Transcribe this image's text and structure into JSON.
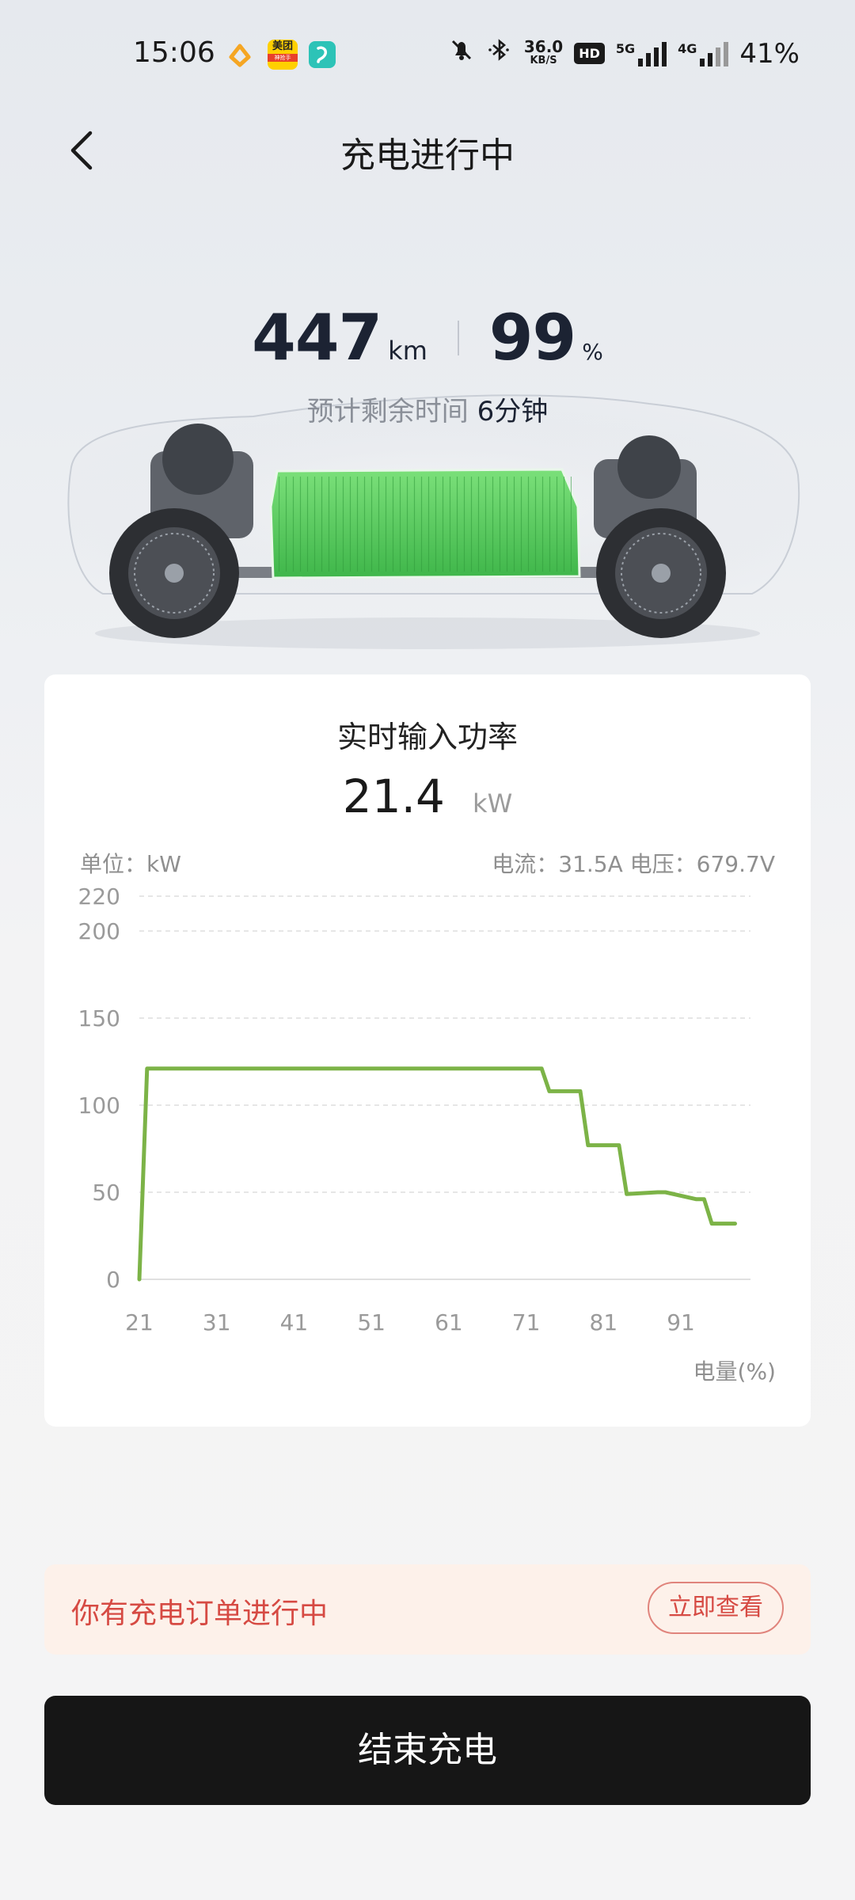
{
  "status_bar": {
    "time": "15:06",
    "speed_value": "36.0",
    "speed_unit": "KB/S",
    "hd_badge": "HD",
    "net1": "5G",
    "net2": "4G",
    "battery": "41%",
    "app_icons": [
      "taobao-flash-icon",
      "meituan-icon",
      "teal-app-icon"
    ],
    "icons": [
      "mute-bell-icon",
      "bluetooth-icon",
      "signal-5g-icon",
      "signal-4g-icon"
    ],
    "meituan_label": "美团",
    "meituan_sub": "神抢手"
  },
  "header": {
    "title": "充电进行中"
  },
  "stats": {
    "range_value": "447",
    "range_unit": "km",
    "soc_value": "99",
    "soc_unit": "%",
    "eta_label": "预计剩余时间",
    "eta_value": "6分钟"
  },
  "card": {
    "title": "实时输入功率",
    "power_value": "21.4",
    "power_unit": "kW",
    "unit_label": "单位：kW",
    "current_voltage": "电流：31.5A   电压：679.7V"
  },
  "chart_data": {
    "type": "line",
    "x_label": "电量(%)",
    "y_unit": "kW",
    "x_ticks": [
      21,
      31,
      41,
      51,
      61,
      71,
      81,
      91
    ],
    "y_ticks": [
      0,
      50,
      100,
      150,
      200,
      220
    ],
    "xlim": [
      21,
      100
    ],
    "ylim": [
      0,
      220
    ],
    "grid": true,
    "line_color": "#7cb347",
    "series": [
      {
        "x": [
          21,
          22,
          31,
          41,
          51,
          61,
          71,
          73,
          74,
          78,
          79,
          83,
          84,
          88,
          89,
          93,
          94,
          95,
          98
        ],
        "y": [
          0,
          121,
          121,
          121,
          121,
          121,
          121,
          121,
          108,
          108,
          77,
          77,
          49,
          50,
          50,
          46,
          46,
          32,
          32
        ]
      }
    ]
  },
  "banner": {
    "text": "你有充电订单进行中",
    "button": "立即查看"
  },
  "end_button": "结束充电",
  "colors": {
    "battery_green": "#5bd05f",
    "banner_red": "#d64a43",
    "button_dark": "#161616"
  }
}
